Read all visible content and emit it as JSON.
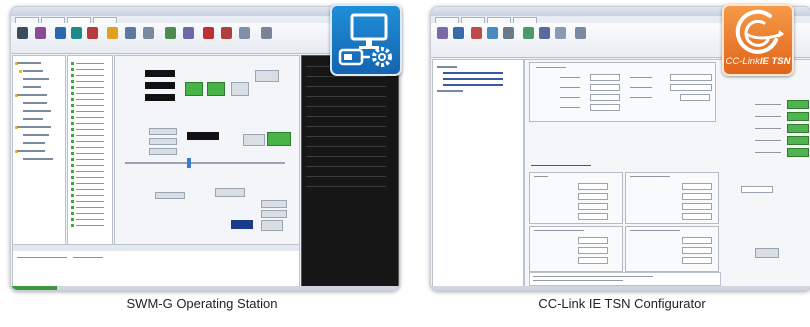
{
  "panels": [
    {
      "caption": "SWM-G Operating Station",
      "icon": "monitor-usb-gear-icon",
      "tile_color": "#1a78c8"
    },
    {
      "caption": "CC-Link IE TSN Configurator",
      "icon": "cclink-ie-tsn-logo-icon",
      "tile_color": "#ec7d2e",
      "logo_text_prefix": "CC-Link",
      "logo_text_suffix": "IE TSN"
    }
  ],
  "colors": {
    "accent_blue": "#1a78c8",
    "accent_orange": "#ec7d2e",
    "status_green": "#48b448"
  }
}
